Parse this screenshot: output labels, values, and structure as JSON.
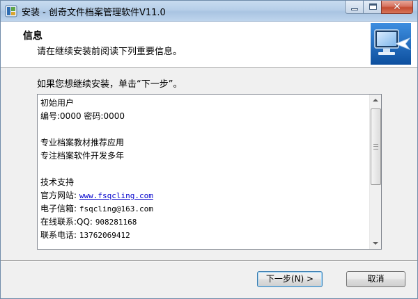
{
  "window": {
    "title": "安装 - 创奇文件档案管理软件V11.0",
    "controls": {
      "close": "✕"
    }
  },
  "header": {
    "title": "信息",
    "subtitle": "请在继续安装前阅读下列重要信息。"
  },
  "prompt": "如果您想继续安装，单击“下一步”。",
  "info": {
    "lines": [
      "初始用户",
      "编号:0000    密码:0000",
      "",
      "专业档案教材推荐应用",
      "专注档案软件开发多年",
      "",
      "技术支持"
    ],
    "website_label": "官方网站:",
    "website_url": "www.fsqcling.com",
    "email_label": "电子信箱:",
    "email_value": "fsqcling@163.com",
    "contact_label": "在线联系:QQ:",
    "contact_value": "908281168",
    "phone_label": "联系电话:",
    "phone_value": "13762069412"
  },
  "buttons": {
    "next": "下一步(N) >",
    "cancel": "取消"
  },
  "colors": {
    "link": "#0000cc",
    "header_icon_bg": "#1f6fc5"
  }
}
